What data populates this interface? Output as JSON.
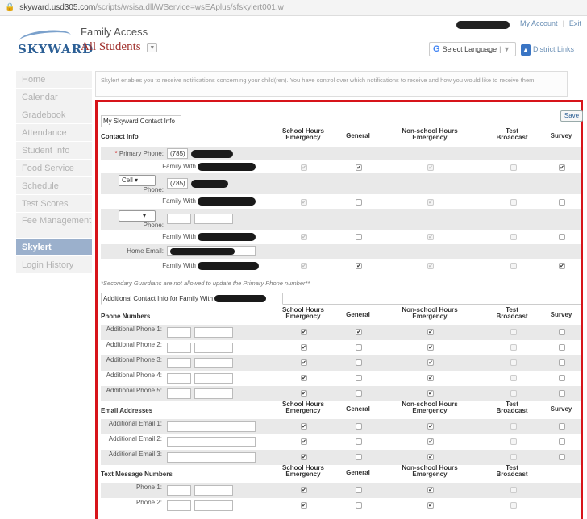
{
  "browser": {
    "url_host": "skyward.usd305.com",
    "url_path": "/scripts/wsisa.dll/WService=wsEAplus/sfskylert001.w"
  },
  "header": {
    "logo_text": "SKYWARD",
    "app_title": "Family Access",
    "student_selector": "All Students",
    "my_account": "My Account",
    "exit": "Exit",
    "select_language": "Select Language",
    "district_links": "District Links"
  },
  "sidebar": {
    "items": [
      {
        "label": "Home"
      },
      {
        "label": "Calendar"
      },
      {
        "label": "Gradebook"
      },
      {
        "label": "Attendance"
      },
      {
        "label": "Student Info"
      },
      {
        "label": "Food Service"
      },
      {
        "label": "Schedule"
      },
      {
        "label": "Test Scores"
      },
      {
        "label": "Fee Management"
      },
      {
        "label": "Skylert"
      },
      {
        "label": "Login History"
      }
    ],
    "active": "Skylert"
  },
  "info_text": "Skylert enables you to receive notifications concerning your child(ren). You have control over which notifications to receive and how you would like to receive them.",
  "save_label": "Save",
  "contact_tab_label": "My Skyward Contact Info",
  "additional_tab_label": "Additional Contact Info for Family With",
  "secondary_note": "*Secondary Guardians are not allowed to update the Primary Phone number**",
  "column_headers": {
    "school_hours": "School Hours Emergency",
    "general": "General",
    "non_school_hours": "Non-school Hours Emergency",
    "test_broadcast": "Test Broadcast",
    "survey": "Survey"
  },
  "sections": {
    "contact_info": "Contact Info",
    "phone_numbers": "Phone Numbers",
    "email_addresses": "Email Addresses",
    "text_message_numbers": "Text Message Numbers"
  },
  "contact_info": {
    "primary_phone_label": "Primary Phone:",
    "primary_phone_area": "(785)",
    "cell_select": "Cell",
    "phone_label": "Phone:",
    "cell_phone_area": "(785)",
    "home_email_label": "Home Email:",
    "family_with_label": "Family With",
    "checks": [
      {
        "school": true,
        "general": true,
        "non_school": true,
        "test": false,
        "survey": true
      },
      {
        "school": true,
        "general": false,
        "non_school": true,
        "test": false,
        "survey": false
      },
      {
        "school": true,
        "general": false,
        "non_school": true,
        "test": false,
        "survey": false
      },
      {
        "school": true,
        "general": true,
        "non_school": true,
        "test": false,
        "survey": true
      }
    ]
  },
  "additional_phones": [
    {
      "label": "Additional Phone 1:"
    },
    {
      "label": "Additional Phone 2:"
    },
    {
      "label": "Additional Phone 3:"
    },
    {
      "label": "Additional Phone 4:"
    },
    {
      "label": "Additional Phone 5:"
    }
  ],
  "additional_phone_checks": [
    {
      "school": true,
      "general": true,
      "non_school": true,
      "test": false,
      "survey": false
    },
    {
      "school": true,
      "general": false,
      "non_school": true,
      "test": false,
      "survey": false
    },
    {
      "school": true,
      "general": false,
      "non_school": true,
      "test": false,
      "survey": false
    },
    {
      "school": true,
      "general": false,
      "non_school": true,
      "test": false,
      "survey": false
    },
    {
      "school": true,
      "general": false,
      "non_school": true,
      "test": false,
      "survey": false
    }
  ],
  "additional_emails": [
    {
      "label": "Additional Email 1:"
    },
    {
      "label": "Additional Email 2:"
    },
    {
      "label": "Additional Email 3:"
    }
  ],
  "additional_email_checks": [
    {
      "school": true,
      "general": false,
      "non_school": true,
      "test": false,
      "survey": false
    },
    {
      "school": true,
      "general": false,
      "non_school": true,
      "test": false,
      "survey": false
    },
    {
      "school": true,
      "general": false,
      "non_school": true,
      "test": false,
      "survey": false
    }
  ],
  "text_phones": [
    {
      "label": "Phone 1:"
    },
    {
      "label": "Phone 2:"
    }
  ],
  "text_phone_checks": [
    {
      "school": true,
      "general": false,
      "non_school": true,
      "test": false
    },
    {
      "school": true,
      "general": false,
      "non_school": true,
      "test": false
    }
  ],
  "colors": {
    "accent_red": "#d7141a",
    "nav_active": "#9bb0cc",
    "brand_blue": "#2c5f95",
    "student_red": "#a0302c"
  }
}
